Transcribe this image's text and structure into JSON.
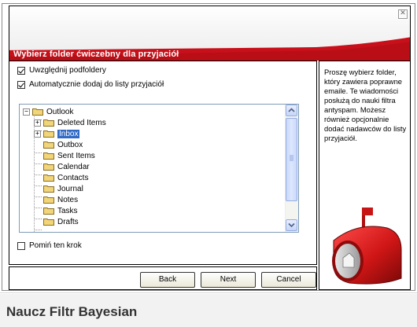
{
  "dialog": {
    "title": "Wybierz folder ćwiczebny dla przyjaciół",
    "close_symbol": "✕"
  },
  "options": {
    "include_subfolders": {
      "label": "Uwzględnij podfoldery",
      "checked": true
    },
    "auto_add_friends": {
      "label": "Automatycznie dodaj do listy przyjaciół",
      "checked": true
    },
    "skip_step": {
      "label": "Pomiń ten krok",
      "checked": false
    }
  },
  "tree": {
    "root": "Outlook",
    "items": [
      {
        "label": "Deleted Items",
        "expandable": true,
        "selected": false
      },
      {
        "label": "Inbox",
        "expandable": true,
        "selected": true
      },
      {
        "label": "Outbox",
        "expandable": false,
        "selected": false
      },
      {
        "label": "Sent Items",
        "expandable": false,
        "selected": false
      },
      {
        "label": "Calendar",
        "expandable": false,
        "selected": false
      },
      {
        "label": "Contacts",
        "expandable": false,
        "selected": false
      },
      {
        "label": "Journal",
        "expandable": false,
        "selected": false
      },
      {
        "label": "Notes",
        "expandable": false,
        "selected": false
      },
      {
        "label": "Tasks",
        "expandable": false,
        "selected": false
      },
      {
        "label": "Drafts",
        "expandable": false,
        "selected": false
      }
    ]
  },
  "help": {
    "text": "Proszę wybierz folder, który zawiera poprawne emaile. Te wiadomości posłużą do nauki filtra antyspam. Możesz również opcjonalnie dodać nadawców do listy przyjaciół."
  },
  "buttons": {
    "back": "Back",
    "next": "Next",
    "cancel": "Cancel"
  },
  "footer": {
    "title": "Naucz Filtr Bayesian"
  },
  "colors": {
    "brand_red": "#c8101a",
    "selection": "#316ac5",
    "folder": "#f1d57a"
  },
  "icons": {
    "mailbox": "mailbox-icon",
    "folder": "folder-icon"
  }
}
